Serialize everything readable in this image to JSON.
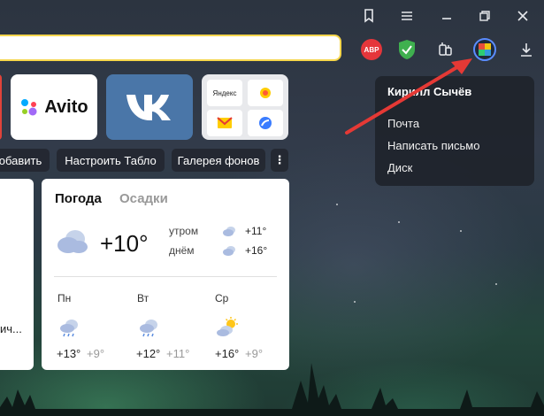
{
  "new_tab": {
    "tiles": [
      {
        "label": "Avito"
      },
      {
        "label": "VK"
      },
      {
        "label": "Яндекс"
      }
    ],
    "buttons": {
      "add": "обавить",
      "customize": "Настроить Табло",
      "gallery": "Галерея фонов",
      "more": "⋮"
    },
    "left_card_text": "ич..."
  },
  "weather": {
    "tab_weather": "Погода",
    "tab_precip": "Осадки",
    "current_temp": "+10°",
    "morning_label": "утром",
    "morning_temp": "+11°",
    "day_label": "днём",
    "day_temp": "+16°",
    "forecast": [
      {
        "day": "Пн",
        "hi": "+13°",
        "lo": "+9°"
      },
      {
        "day": "Вт",
        "hi": "+12°",
        "lo": "+11°"
      },
      {
        "day": "Ср",
        "hi": "+16°",
        "lo": "+9°"
      }
    ]
  },
  "profile_popup": {
    "name": "Кирилл Сычёв",
    "items": [
      "Почта",
      "Написать письмо",
      "Диск"
    ]
  },
  "extensions": {
    "abp": "ABP"
  },
  "colors": {
    "address_border": "#f6d64c",
    "vk_blue": "#4a76a8",
    "arrow_red": "#e53935"
  }
}
